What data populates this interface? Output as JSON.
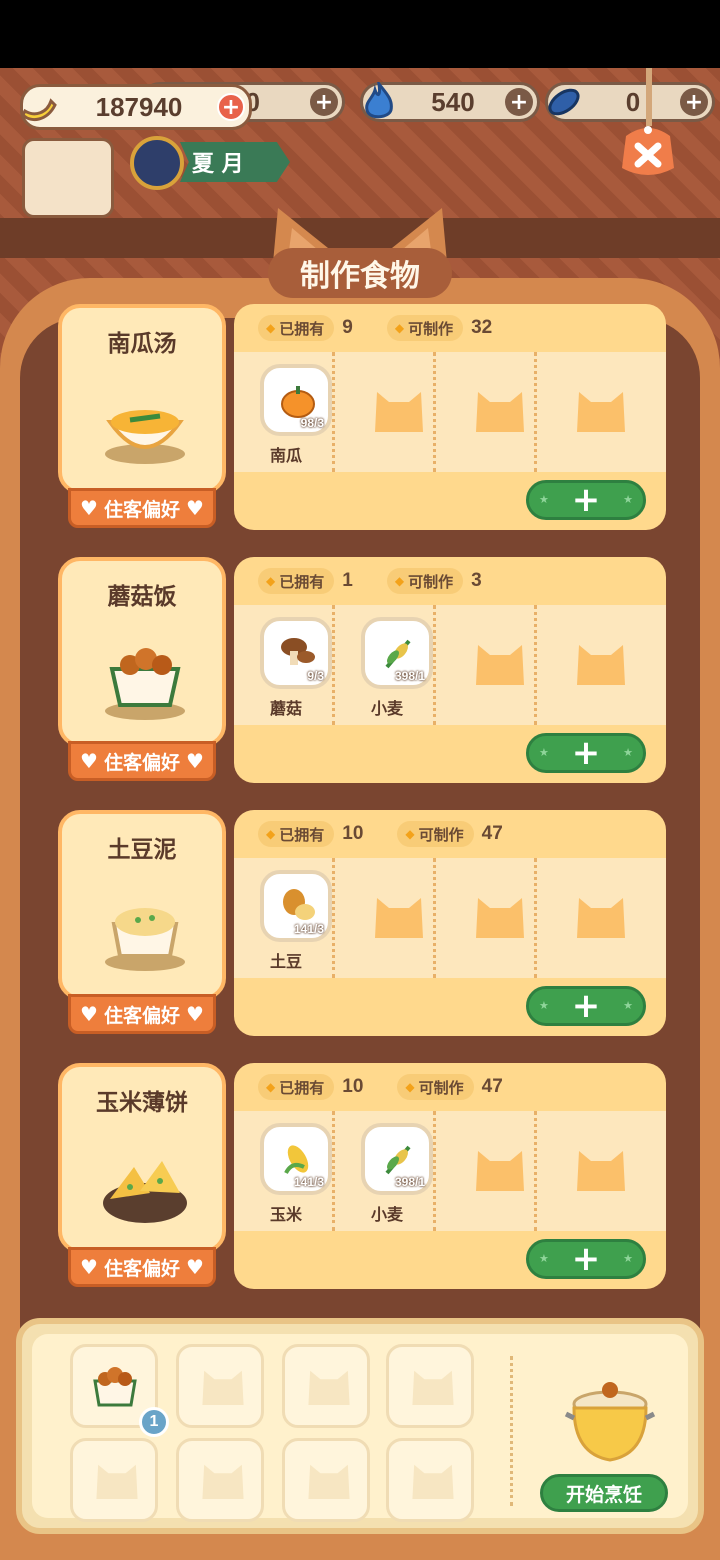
{
  "resources": {
    "banana": "187940",
    "res2": "40",
    "flame": "540",
    "fish": "0"
  },
  "season": {
    "label": "夏 月"
  },
  "title": "制作食物",
  "labels": {
    "owned": "已拥有",
    "craftable": "可制作",
    "preference": "住客偏好",
    "add": "+"
  },
  "recipes": [
    {
      "name": "南瓜汤",
      "owned": "9",
      "craftable": "32",
      "ingredients": [
        {
          "name": "南瓜",
          "count": "98/3",
          "icon": "pumpkin-icon"
        }
      ]
    },
    {
      "name": "蘑菇饭",
      "owned": "1",
      "craftable": "3",
      "ingredients": [
        {
          "name": "蘑菇",
          "count": "9/3",
          "icon": "mushroom-icon"
        },
        {
          "name": "小麦",
          "count": "398/1",
          "icon": "wheat-icon"
        }
      ]
    },
    {
      "name": "土豆泥",
      "owned": "10",
      "craftable": "47",
      "ingredients": [
        {
          "name": "土豆",
          "count": "141/3",
          "icon": "potato-icon"
        }
      ]
    },
    {
      "name": "玉米薄饼",
      "owned": "10",
      "craftable": "47",
      "ingredients": [
        {
          "name": "玉米",
          "count": "141/3",
          "icon": "corn-icon"
        },
        {
          "name": "小麦",
          "count": "398/1",
          "icon": "wheat-icon"
        }
      ]
    }
  ],
  "tray": {
    "first_badge": "1",
    "cook_label": "开始烹饪"
  },
  "colors": {
    "accent_green": "#3fa04e",
    "panel_orange": "#d4884e",
    "card_cream": "#ffe9b8"
  }
}
